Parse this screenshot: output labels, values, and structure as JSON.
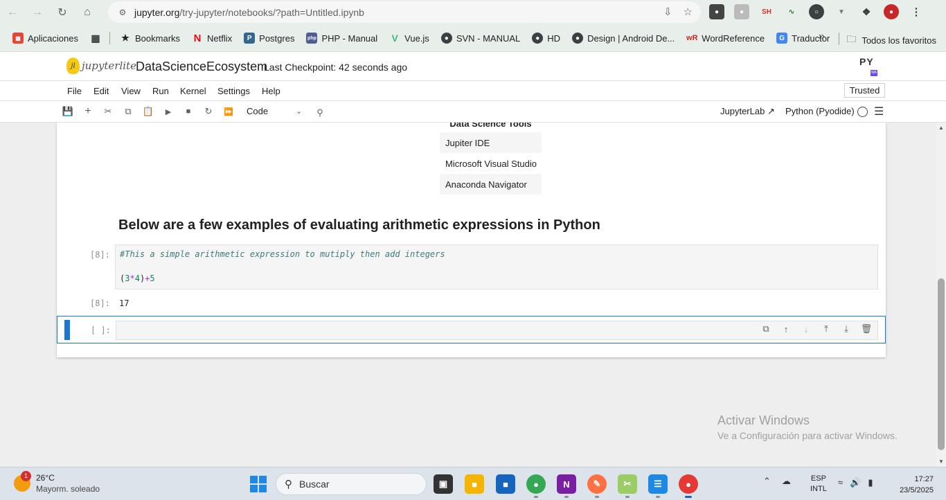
{
  "browser": {
    "url_domain": "jupyter.org",
    "url_path": "/try-jupyter/notebooks/?path=Untitled.ipynb"
  },
  "bookmarks": {
    "items": [
      "Aplicaciones",
      "Bookmarks",
      "Netflix",
      "Postgres",
      "PHP - Manual",
      "Vue.js",
      "SVN - MANUAL",
      "HD",
      "Design | Android De...",
      "WordReference",
      "Traductor"
    ],
    "all_favorites": "Todos los favoritos"
  },
  "jupyter": {
    "logo_text": "jupyterlite",
    "notebook_title": "DataScienceEcosystem",
    "checkpoint": "Last Checkpoint: 42 seconds ago",
    "menu": [
      "File",
      "Edit",
      "View",
      "Run",
      "Kernel",
      "Settings",
      "Help"
    ],
    "trusted": "Trusted",
    "cell_type": "Code",
    "jupyterlab_link": "JupyterLab",
    "kernel": "Python (Pyodide)"
  },
  "notebook": {
    "tools_table": {
      "header": "Data Science Tools",
      "rows": [
        "Jupiter IDE",
        "Microsoft Visual Studio",
        "Anaconda Navigator"
      ]
    },
    "markdown_heading": "Below are a few examples of evaluating arithmetic expressions in Python",
    "code_cell": {
      "prompt": "[8]:",
      "comment": "#This a simple arithmetic expression to mutiply then add integers",
      "code_parts": [
        "(",
        "3",
        "*",
        "4",
        ")",
        "+",
        "5"
      ]
    },
    "output": {
      "prompt": "[8]:",
      "value": "17"
    },
    "active_cell": {
      "prompt": "[ ]:"
    }
  },
  "watermark": {
    "title": "Activar Windows",
    "subtitle": "Ve a Configuración para activar Windows."
  },
  "taskbar": {
    "badge": "1",
    "temperature": "26°C",
    "weather": "Mayorm. soleado",
    "search_placeholder": "Buscar",
    "lang_top": "ESP",
    "lang_bottom": "INTL",
    "time": "17:27",
    "date": "23/5/2025"
  }
}
